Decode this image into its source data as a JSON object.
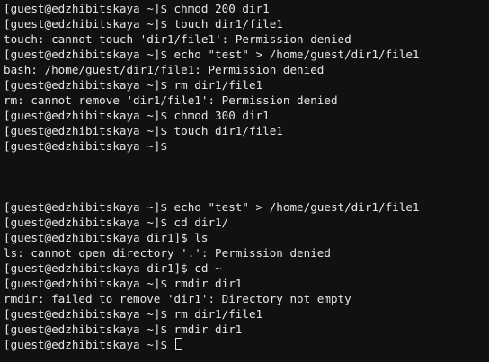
{
  "terminal": {
    "lines": [
      "[guest@edzhibitskaya ~]$ chmod 200 dir1",
      "[guest@edzhibitskaya ~]$ touch dir1/file1",
      "touch: cannot touch 'dir1/file1': Permission denied",
      "[guest@edzhibitskaya ~]$ echo \"test\" > /home/guest/dir1/file1",
      "bash: /home/guest/dir1/file1: Permission denied",
      "[guest@edzhibitskaya ~]$ rm dir1/file1",
      "rm: cannot remove 'dir1/file1': Permission denied",
      "[guest@edzhibitskaya ~]$ chmod 300 dir1",
      "[guest@edzhibitskaya ~]$ touch dir1/file1",
      "[guest@edzhibitskaya ~]$",
      "",
      "",
      "",
      "[guest@edzhibitskaya ~]$ echo \"test\" > /home/guest/dir1/file1",
      "[guest@edzhibitskaya ~]$ cd dir1/",
      "[guest@edzhibitskaya dir1]$ ls",
      "ls: cannot open directory '.': Permission denied",
      "[guest@edzhibitskaya dir1]$ cd ~",
      "[guest@edzhibitskaya ~]$ rmdir dir1",
      "rmdir: failed to remove 'dir1': Directory not empty",
      "[guest@edzhibitskaya ~]$ rm dir1/file1",
      "[guest@edzhibitskaya ~]$ rmdir dir1",
      "[guest@edzhibitskaya ~]$ "
    ]
  }
}
